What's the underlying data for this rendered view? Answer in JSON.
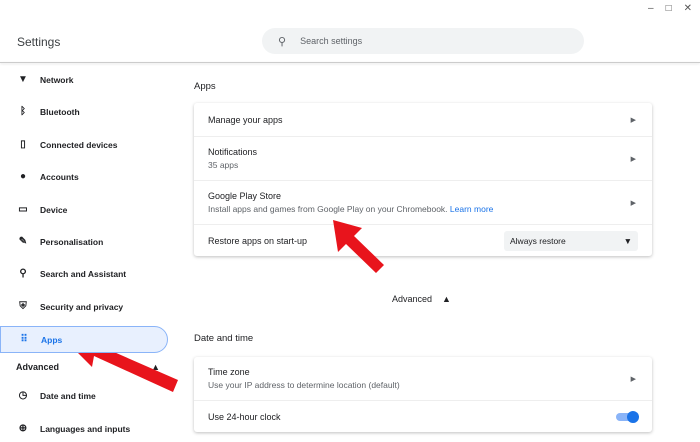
{
  "window": {
    "minimize": "–",
    "maximize": "□",
    "close": "✕"
  },
  "header": {
    "title": "Settings",
    "search_placeholder": "Search settings"
  },
  "sidebar": {
    "items": [
      {
        "label": "Network",
        "icon": "wifi-icon",
        "glyph": "▼"
      },
      {
        "label": "Bluetooth",
        "icon": "bluetooth-icon",
        "glyph": "ᛒ"
      },
      {
        "label": "Connected devices",
        "icon": "phone-icon",
        "glyph": "▯"
      },
      {
        "label": "Accounts",
        "icon": "person-icon",
        "glyph": "●"
      },
      {
        "label": "Device",
        "icon": "laptop-icon",
        "glyph": "▭"
      },
      {
        "label": "Personalisation",
        "icon": "brush-icon",
        "glyph": "✎"
      },
      {
        "label": "Search and Assistant",
        "icon": "search-icon",
        "glyph": "⚲"
      },
      {
        "label": "Security and privacy",
        "icon": "shield-icon",
        "glyph": "⛨"
      },
      {
        "label": "Apps",
        "icon": "apps-grid-icon",
        "glyph": "⠿"
      }
    ],
    "advanced": "Advanced",
    "advanced_items": [
      {
        "label": "Date and time",
        "icon": "clock-icon",
        "glyph": "◷"
      },
      {
        "label": "Languages and inputs",
        "icon": "globe-icon",
        "glyph": "⊕"
      }
    ]
  },
  "main": {
    "apps_title": "Apps",
    "manage": "Manage your apps",
    "notifications": {
      "title": "Notifications",
      "sub": "35 apps"
    },
    "play": {
      "title": "Google Play Store",
      "sub": "Install apps and games from Google Play on your Chromebook.",
      "link": "Learn more"
    },
    "restore": {
      "label": "Restore apps on start-up",
      "value": "Always restore"
    },
    "advanced": "Advanced",
    "datetime_title": "Date and time",
    "timezone": {
      "title": "Time zone",
      "sub": "Use your IP address to determine location (default)"
    },
    "clock24": {
      "label": "Use 24-hour clock",
      "on": true
    }
  },
  "colors": {
    "accent": "#1a73e8",
    "annotation_arrow": "#e8141c"
  }
}
